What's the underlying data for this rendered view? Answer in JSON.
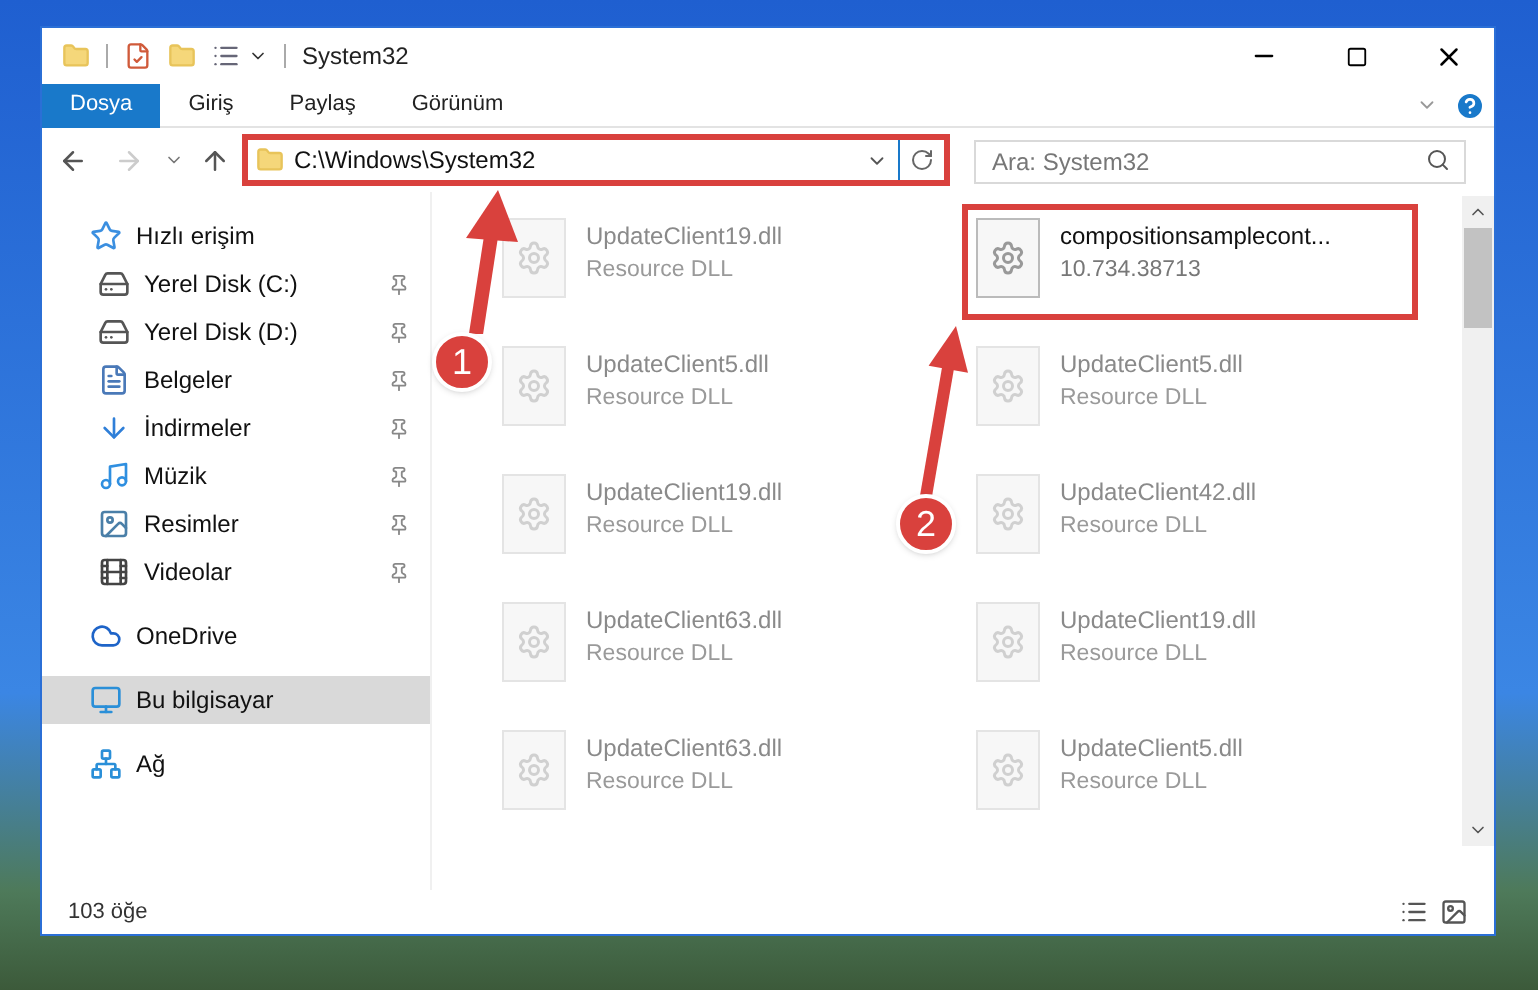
{
  "window": {
    "title": "System32"
  },
  "ribbon_tabs": [
    {
      "label": "Dosya",
      "selected": true
    },
    {
      "label": "Giriş",
      "selected": false
    },
    {
      "label": "Paylaş",
      "selected": false
    },
    {
      "label": "Görünüm",
      "selected": false
    }
  ],
  "address": {
    "path": "C:\\Windows\\System32",
    "highlighted": true
  },
  "search": {
    "placeholder": "Ara: System32"
  },
  "sidebar": {
    "items": [
      {
        "label": "Hızlı erişim",
        "kind": "star",
        "selected": false,
        "children": [
          {
            "label": "Yerel Disk (C:)",
            "kind": "drive",
            "pinned": true,
            "selected": false
          },
          {
            "label": "Yerel Disk (D:)",
            "kind": "drive",
            "pinned": true,
            "selected": false
          },
          {
            "label": "Belgeler",
            "kind": "document",
            "pinned": true,
            "selected": false
          },
          {
            "label": "İndirmeler",
            "kind": "download",
            "pinned": true,
            "selected": false
          },
          {
            "label": "Müzik",
            "kind": "music",
            "pinned": true,
            "selected": false
          },
          {
            "label": "Resimler",
            "kind": "pictures",
            "pinned": true,
            "selected": false
          },
          {
            "label": "Videolar",
            "kind": "video",
            "pinned": true,
            "selected": false
          }
        ]
      },
      {
        "label": "OneDrive",
        "kind": "cloud",
        "selected": false
      },
      {
        "label": "Bu bilgisayar",
        "kind": "computer",
        "selected": true
      },
      {
        "label": "Ağ",
        "kind": "network",
        "selected": false
      }
    ]
  },
  "files": [
    {
      "name": "UpdateClient19.dll",
      "detail": "Resource DLL",
      "highlighted": false
    },
    {
      "name": "compositionsamplecont...",
      "detail": "10.734.38713",
      "highlighted": true
    },
    {
      "name": "UpdateClient5.dll",
      "detail": "Resource DLL",
      "highlighted": false
    },
    {
      "name": "UpdateClient5.dll",
      "detail": "Resource DLL",
      "highlighted": false
    },
    {
      "name": "UpdateClient19.dll",
      "detail": "Resource DLL",
      "highlighted": false
    },
    {
      "name": "UpdateClient42.dll",
      "detail": "Resource DLL",
      "highlighted": false
    },
    {
      "name": "UpdateClient63.dll",
      "detail": "Resource DLL",
      "highlighted": false
    },
    {
      "name": "UpdateClient19.dll",
      "detail": "Resource DLL",
      "highlighted": false
    },
    {
      "name": "UpdateClient63.dll",
      "detail": "Resource DLL",
      "highlighted": false
    },
    {
      "name": "UpdateClient5.dll",
      "detail": "Resource DLL",
      "highlighted": false
    }
  ],
  "status_bar": {
    "count": "103 öğe"
  },
  "annotations": [
    {
      "label": "1"
    },
    {
      "label": "2"
    }
  ]
}
